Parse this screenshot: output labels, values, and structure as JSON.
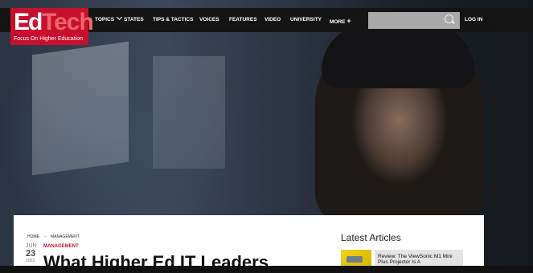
{
  "brand": {
    "logo_ed": "Ed",
    "logo_tech": "Tech",
    "tagline": "Focus On Higher Education"
  },
  "nav": {
    "topics": "TOPICS",
    "states": "STATES",
    "tips": "TIPS & TACTICS",
    "voices": "VOICES",
    "features": "FEATURES",
    "video": "VIDEO",
    "university": "UNIVERSITY",
    "more": "MORE",
    "more_icon": "+",
    "login": "LOG IN"
  },
  "search": {
    "icon": "search-icon"
  },
  "breadcrumb": {
    "home": "HOME",
    "separator": "»",
    "section": "MANAGEMENT"
  },
  "article": {
    "date_month": "JUN",
    "date_day": "23",
    "date_year": "2023",
    "category": "MANAGEMENT",
    "headline": "What Higher Ed IT Leaders"
  },
  "sidebar": {
    "title": "Latest Articles",
    "items": [
      {
        "title": "Review: The ViewSonic M1 Mini Plus Projector Is A"
      }
    ]
  },
  "colors": {
    "brand_red": "#c8102e",
    "nav_bg": "#141414"
  }
}
